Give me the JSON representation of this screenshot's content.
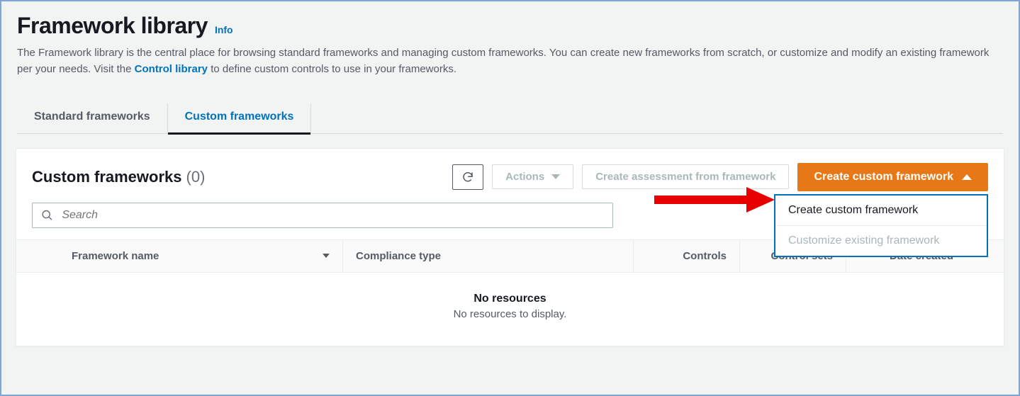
{
  "header": {
    "title": "Framework library",
    "info_label": "Info",
    "description_prefix": "The Framework library is the central place for browsing standard frameworks and managing custom frameworks. You can create new frameworks from scratch, or customize and modify an existing framework per your needs. Visit the ",
    "description_link": "Control library",
    "description_suffix": " to define custom controls to use in your frameworks."
  },
  "tabs": {
    "standard": "Standard frameworks",
    "custom": "Custom frameworks"
  },
  "panel": {
    "title": "Custom frameworks",
    "count": "(0)",
    "actions_label": "Actions",
    "create_assessment_label": "Create assessment from framework",
    "create_custom_label": "Create custom framework"
  },
  "dropdown": {
    "item_create": "Create custom framework",
    "item_customize": "Customize existing framework"
  },
  "search": {
    "placeholder": "Search"
  },
  "columns": {
    "name": "Framework name",
    "compliance": "Compliance type",
    "controls": "Controls",
    "control_sets": "Control sets",
    "date": "Date created"
  },
  "empty": {
    "title": "No resources",
    "desc": "No resources to display."
  }
}
